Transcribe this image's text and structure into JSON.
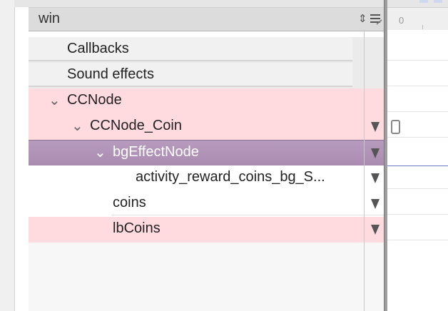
{
  "header": {
    "title": "win",
    "sort_glyph": "⇕",
    "menu_icon": "list-menu-icon"
  },
  "timeline": {
    "zero_label": "0"
  },
  "tree": {
    "sections": [
      {
        "label": "Callbacks"
      },
      {
        "label": "Sound effects"
      }
    ],
    "nodes": [
      {
        "label": "CCNode",
        "expanded": true,
        "level": 0
      },
      {
        "label": "CCNode_Coin",
        "expanded": true,
        "level": 1
      },
      {
        "label": "bgEffectNode",
        "expanded": true,
        "level": 2,
        "selected": true
      },
      {
        "label": "activity_reward_coins_bg_S...",
        "level": 3
      },
      {
        "label": "coins",
        "level": 2
      },
      {
        "label": "lbCoins",
        "level": 2
      }
    ]
  },
  "glyphs": {
    "chevron_down": "⌄"
  },
  "colors": {
    "highlight": "#ffdbe0",
    "selected": "#a98bb0"
  }
}
